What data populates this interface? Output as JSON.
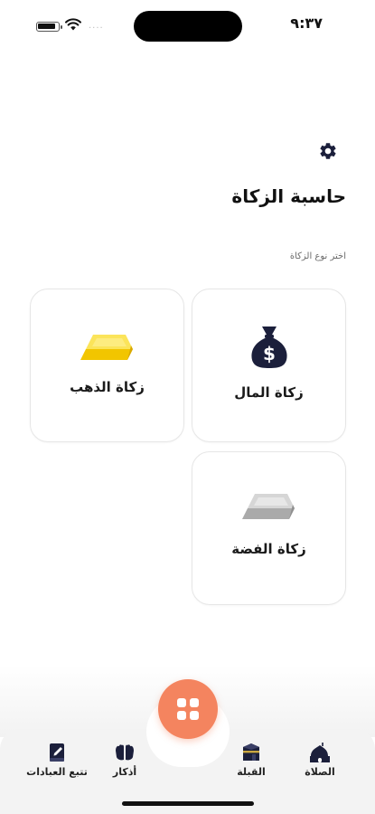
{
  "status_bar": {
    "time": "٩:٣٧",
    "signal_dots": "····"
  },
  "header": {
    "title": "حاسبة الزكاة",
    "settings_icon": "gear-icon"
  },
  "section_hint": "اختر نوع الزكاة",
  "cards": [
    {
      "label": "زكاة المال",
      "icon": "money-bag-icon"
    },
    {
      "label": "زكاة الذهب",
      "icon": "gold-bar-icon"
    },
    {
      "label": "زكاة الفضة",
      "icon": "silver-bar-icon"
    }
  ],
  "fab": {
    "icon": "grid-icon"
  },
  "bottom_nav": [
    {
      "label": "الصلاة",
      "icon": "mosque-icon"
    },
    {
      "label": "القبلة",
      "icon": "kaaba-icon"
    },
    {
      "label": "أذكار",
      "icon": "praying-hands-icon"
    },
    {
      "label": "تتبع العبادات",
      "icon": "book-icon"
    }
  ],
  "colors": {
    "accent": "#f4845f",
    "icon_dark": "#1b1f3b",
    "gold": "#f7d31a",
    "silver": "#b8b8b8"
  }
}
